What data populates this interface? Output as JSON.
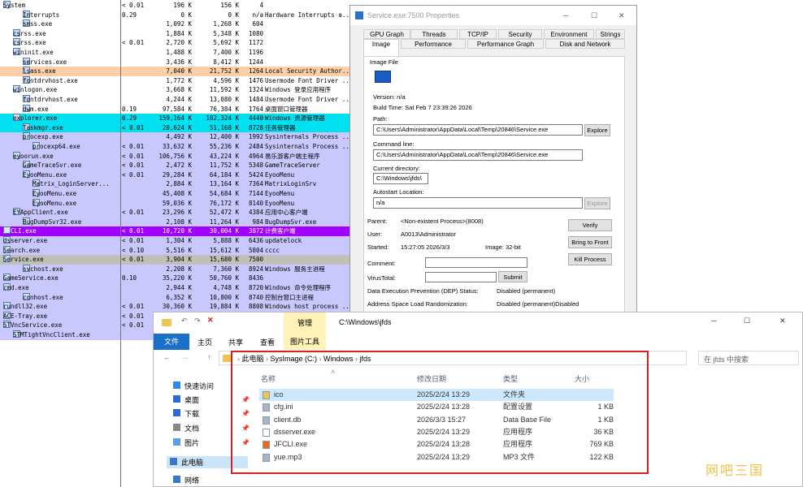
{
  "procexp": {
    "rows": [
      {
        "name": "System",
        "cpu": "< 0.01",
        "priv": "196 K",
        "ws": "156 K",
        "pid": "4",
        "desc": "",
        "bg": "#ffffff",
        "indent": 0
      },
      {
        "name": "Interrupts",
        "cpu": "0.29",
        "priv": "0 K",
        "ws": "0 K",
        "pid": "n/a",
        "desc": "Hardware Interrupts a...",
        "bg": "#ffffff",
        "indent": 2
      },
      {
        "name": "smss.exe",
        "cpu": "",
        "priv": "1,092 K",
        "ws": "1,268 K",
        "pid": "604",
        "desc": "",
        "bg": "#ffffff",
        "indent": 2
      },
      {
        "name": "csrss.exe",
        "cpu": "",
        "priv": "1,884 K",
        "ws": "5,348 K",
        "pid": "1080",
        "desc": "",
        "bg": "#ffffff",
        "indent": 1
      },
      {
        "name": "csrss.exe",
        "cpu": "< 0.01",
        "priv": "2,720 K",
        "ws": "5,692 K",
        "pid": "1172",
        "desc": "",
        "bg": "#ffffff",
        "indent": 1
      },
      {
        "name": "wininit.exe",
        "cpu": "",
        "priv": "1,488 K",
        "ws": "7,400 K",
        "pid": "1196",
        "desc": "",
        "bg": "#ffffff",
        "indent": 1
      },
      {
        "name": "services.exe",
        "cpu": "",
        "priv": "3,436 K",
        "ws": "8,412 K",
        "pid": "1244",
        "desc": "",
        "bg": "#ffffff",
        "indent": 2
      },
      {
        "name": "lsass.exe",
        "cpu": "",
        "priv": "7,040 K",
        "ws": "21,752 K",
        "pid": "1264",
        "desc": "Local Security Author...",
        "bg": "#ffd0a8",
        "indent": 2
      },
      {
        "name": "fontdrvhost.exe",
        "cpu": "",
        "priv": "1,772 K",
        "ws": "4,596 K",
        "pid": "1476",
        "desc": "Usermode Font Driver ...",
        "bg": "#ffffff",
        "indent": 2
      },
      {
        "name": "winlogon.exe",
        "cpu": "",
        "priv": "3,668 K",
        "ws": "11,592 K",
        "pid": "1324",
        "desc": "Windows 登录应用程序",
        "bg": "#ffffff",
        "indent": 1
      },
      {
        "name": "fontdrvhost.exe",
        "cpu": "",
        "priv": "4,244 K",
        "ws": "13,080 K",
        "pid": "1484",
        "desc": "Usermode Font Driver ...",
        "bg": "#ffffff",
        "indent": 2
      },
      {
        "name": "dwm.exe",
        "cpu": "0.19",
        "priv": "97,584 K",
        "ws": "76,384 K",
        "pid": "1764",
        "desc": "桌面窗口管理器",
        "bg": "#ffffff",
        "indent": 2
      },
      {
        "name": "explorer.exe",
        "cpu": "0.29",
        "priv": "159,164 K",
        "ws": "182,324 K",
        "pid": "4440",
        "desc": "Windows 资源管理器",
        "bg": "#00e0f0",
        "indent": 1
      },
      {
        "name": "Taskmgr.exe",
        "cpu": "< 0.01",
        "priv": "20,624 K",
        "ws": "51,168 K",
        "pid": "8728",
        "desc": "任务管理器",
        "bg": "#00e0f0",
        "indent": 2
      },
      {
        "name": "procexp.exe",
        "cpu": "",
        "priv": "4,492 K",
        "ws": "12,400 K",
        "pid": "1992",
        "desc": "Sysinternals Process ...",
        "bg": "#c8c8ff",
        "indent": 2
      },
      {
        "name": "procexp64.exe",
        "cpu": "< 0.01",
        "priv": "33,632 K",
        "ws": "55,236 K",
        "pid": "2484",
        "desc": "Sysinternals Process ...",
        "bg": "#c8c8ff",
        "indent": 3
      },
      {
        "name": "eyoorun.exe",
        "cpu": "< 0.01",
        "priv": "106,756 K",
        "ws": "43,224 K",
        "pid": "4964",
        "desc": "易乐游客户端主程序",
        "bg": "#c8c8ff",
        "indent": 1
      },
      {
        "name": "GameTraceSvr.exe",
        "cpu": "< 0.01",
        "priv": "2,472 K",
        "ws": "11,752 K",
        "pid": "5348",
        "desc": "GameTraceServer",
        "bg": "#c8c8ff",
        "indent": 2
      },
      {
        "name": "EyooMenu.exe",
        "cpu": "< 0.01",
        "priv": "29,284 K",
        "ws": "64,184 K",
        "pid": "5424",
        "desc": "EyooMenu",
        "bg": "#c8c8ff",
        "indent": 2
      },
      {
        "name": "Matrix_LoginServer...",
        "cpu": "",
        "priv": "2,884 K",
        "ws": "13,164 K",
        "pid": "7364",
        "desc": "MatrixLoginSrv",
        "bg": "#c8c8ff",
        "indent": 3
      },
      {
        "name": "EyooMenu.exe",
        "cpu": "",
        "priv": "45,408 K",
        "ws": "54,684 K",
        "pid": "7144",
        "desc": "EyooMenu",
        "bg": "#c8c8ff",
        "indent": 3
      },
      {
        "name": "EyooMenu.exe",
        "cpu": "",
        "priv": "59,036 K",
        "ws": "76,172 K",
        "pid": "8140",
        "desc": "EyooMenu",
        "bg": "#c8c8ff",
        "indent": 3
      },
      {
        "name": "EYAppClient.exe",
        "cpu": "< 0.01",
        "priv": "23,296 K",
        "ws": "52,472 K",
        "pid": "4384",
        "desc": "应用中心客户端",
        "bg": "#c8c8ff",
        "indent": 1
      },
      {
        "name": "BugDumpSvr32.exe",
        "cpu": "",
        "priv": "2,108 K",
        "ws": "11,264 K",
        "pid": "984",
        "desc": "BugDumpSvr.exe",
        "bg": "#c8c8ff",
        "indent": 2
      },
      {
        "name": "JFCLI.exe",
        "cpu": "< 0.01",
        "priv": "10,720 K",
        "ws": "30,004 K",
        "pid": "3872",
        "desc": "计费客户端",
        "bg": "#a000ff",
        "indent": 0
      },
      {
        "name": "dsserver.exe",
        "cpu": "< 0.01",
        "priv": "1,304 K",
        "ws": "5,888 K",
        "pid": "6436",
        "desc": "updatelock",
        "bg": "#c8c8ff",
        "indent": 0
      },
      {
        "name": "Search.exe",
        "cpu": "< 0.10",
        "priv": "5,516 K",
        "ws": "15,612 K",
        "pid": "5804",
        "desc": "cccc",
        "bg": "#c8c8ff",
        "indent": 0
      },
      {
        "name": "Service.exe",
        "cpu": "< 0.01",
        "priv": "3,904 K",
        "ws": "15,680 K",
        "pid": "7500",
        "desc": "",
        "bg": "#c0c0b8",
        "indent": 0
      },
      {
        "name": "svchost.exe",
        "cpu": "",
        "priv": "2,208 K",
        "ws": "7,360 K",
        "pid": "8924",
        "desc": "Windows 服务主进程",
        "bg": "#c8c8ff",
        "indent": 2
      },
      {
        "name": "GameService.exe",
        "cpu": "0.10",
        "priv": "35,220 K",
        "ws": "50,760 K",
        "pid": "8436",
        "desc": "",
        "bg": "#c8c8ff",
        "indent": 0
      },
      {
        "name": "cmd.exe",
        "cpu": "",
        "priv": "2,944 K",
        "ws": "4,748 K",
        "pid": "8720",
        "desc": "Windows 命令处理程序",
        "bg": "#c8c8ff",
        "indent": 0
      },
      {
        "name": "conhost.exe",
        "cpu": "",
        "priv": "6,352 K",
        "ws": "10,800 K",
        "pid": "8740",
        "desc": "控制台窗口主进程",
        "bg": "#c8c8ff",
        "indent": 2
      },
      {
        "name": "rundll32.exe",
        "cpu": "< 0.01",
        "priv": "30,360 K",
        "ws": "19,884 K",
        "pid": "8808",
        "desc": "Windows host process ...",
        "bg": "#c8c8ff",
        "indent": 0
      },
      {
        "name": "ACE-Tray.exe",
        "cpu": "< 0.01",
        "priv": "",
        "ws": "",
        "pid": "",
        "desc": "",
        "bg": "#c8c8ff",
        "indent": 0
      },
      {
        "name": "STVncService.exe",
        "cpu": "< 0.01",
        "priv": "",
        "ws": "",
        "pid": "",
        "desc": "",
        "bg": "#c8c8ff",
        "indent": 0
      },
      {
        "name": "STMTightVncClient.exe",
        "cpu": "",
        "priv": "",
        "ws": "",
        "pid": "",
        "desc": "",
        "bg": "#c8c8ff",
        "indent": 1
      }
    ]
  },
  "props": {
    "title": "Service.exe:7500 Properties",
    "tabs_top": [
      "GPU Graph",
      "Threads",
      "TCP/IP",
      "Security",
      "Environment",
      "Strings"
    ],
    "tabs_bottom": [
      "Image",
      "Performance",
      "Performance Graph",
      "Disk and Network"
    ],
    "image_group": "Image File",
    "version": "Version:   n/a",
    "build_time": "Build Time:  Sat Feb  7 23:39:26 2026",
    "path_label": "Path:",
    "path": "C:\\Users\\Administrator\\AppData\\Local\\Temp\\20846\\Service.exe",
    "cmd_label": "Command line:",
    "cmd": "C:\\Users\\Administrator\\AppData\\Local\\Temp\\20846\\Service.exe",
    "cwd_label": "Current directory:",
    "cwd": "C:\\Windows\\jfds\\",
    "autostart_label": "Autostart Location:",
    "autostart": "n/a",
    "explore": "Explore",
    "parent_label": "Parent:",
    "parent": "<Non-existent Process>(8008)",
    "user_label": "User:",
    "user": "A0013\\Administrator",
    "started_label": "Started:",
    "started": "15:27:05   2026/3/3",
    "image_bits": "Image: 32-bit",
    "comment_label": "Comment:",
    "virustotal_label": "VirusTotal:",
    "submit": "Submit",
    "dep_label": "Data Execution Prevention (DEP) Status:",
    "dep": "Disabled (permanent)",
    "aslr_label": "Address Space Load Randomization:",
    "aslr": "Disabled (permanent)Disabled",
    "verify": "Verify",
    "bring_front": "Bring to Front",
    "kill": "Kill Process"
  },
  "explorer": {
    "ribbon_manage": "管理",
    "title_path": "C:\\Windows\\jfds",
    "tab_file": "文件",
    "tab_home": "主页",
    "tab_share": "共享",
    "tab_view": "查看",
    "tab_picture": "图片工具",
    "crumb": [
      "此电脑",
      "SysImage (C:)",
      "Windows",
      "jfds"
    ],
    "search_placeholder": "在 jfds 中搜索",
    "col_name": "名称",
    "col_date": "修改日期",
    "col_type": "类型",
    "col_size": "大小",
    "nav": [
      "快速访问",
      "桌面",
      "下载",
      "文档",
      "图片",
      "此电脑",
      "网络"
    ],
    "files": [
      {
        "name": "ico",
        "date": "2025/2/24 13:29",
        "type": "文件夹",
        "size": ""
      },
      {
        "name": "cfg.ini",
        "date": "2025/2/24 13:28",
        "type": "配置设置",
        "size": "1 KB"
      },
      {
        "name": "client.db",
        "date": "2026/3/3 15:27",
        "type": "Data Base File",
        "size": "1 KB"
      },
      {
        "name": "dsserver.exe",
        "date": "2025/2/24 13:29",
        "type": "应用程序",
        "size": "36 KB"
      },
      {
        "name": "JFCLI.exe",
        "date": "2025/2/24 13:28",
        "type": "应用程序",
        "size": "769 KB"
      },
      {
        "name": "yue.mp3",
        "date": "2025/2/24 13:29",
        "type": "MP3 文件",
        "size": "122 KB"
      }
    ]
  },
  "watermark": "网吧三国"
}
